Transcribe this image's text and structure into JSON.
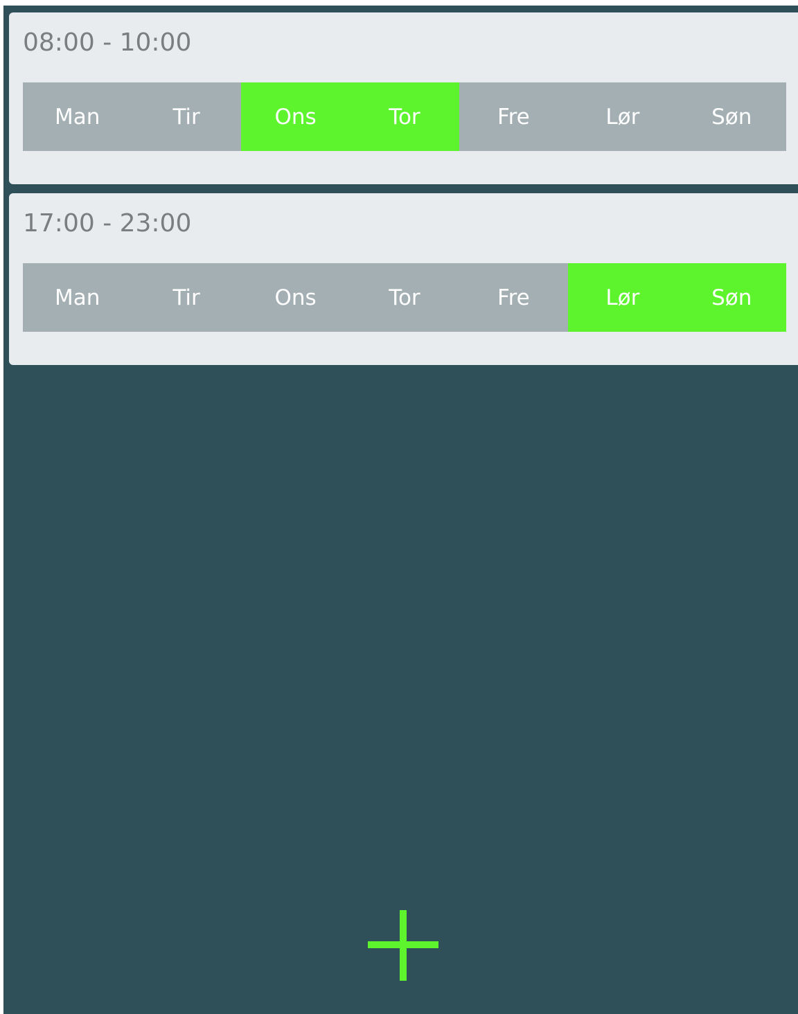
{
  "accent_color": "#5df42e",
  "background_color": "#2f4f59",
  "schedules": [
    {
      "time_range": "08:00 - 10:00",
      "days": [
        {
          "label": "Man",
          "active": false
        },
        {
          "label": "Tir",
          "active": false
        },
        {
          "label": "Ons",
          "active": true
        },
        {
          "label": "Tor",
          "active": true
        },
        {
          "label": "Fre",
          "active": false
        },
        {
          "label": "Lør",
          "active": false
        },
        {
          "label": "Søn",
          "active": false
        }
      ]
    },
    {
      "time_range": "17:00 - 23:00",
      "days": [
        {
          "label": "Man",
          "active": false
        },
        {
          "label": "Tir",
          "active": false
        },
        {
          "label": "Ons",
          "active": false
        },
        {
          "label": "Tor",
          "active": false
        },
        {
          "label": "Fre",
          "active": false
        },
        {
          "label": "Lør",
          "active": true
        },
        {
          "label": "Søn",
          "active": true
        }
      ]
    }
  ],
  "add_button": {
    "icon": "plus-icon"
  }
}
